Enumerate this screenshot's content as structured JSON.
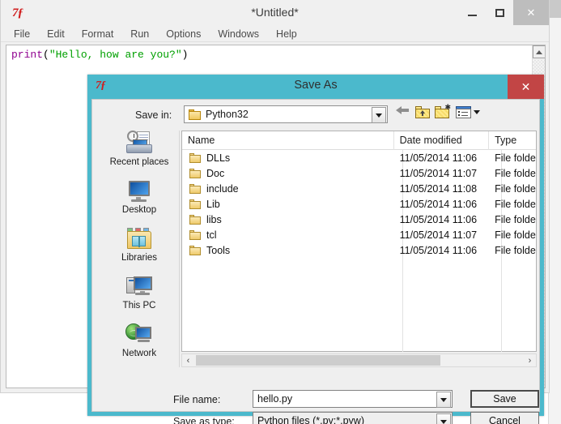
{
  "editor": {
    "window_title": "*Untitled*",
    "icon": "python-idle-icon",
    "icon_glyph": "7ƒ",
    "menus": [
      "File",
      "Edit",
      "Format",
      "Run",
      "Options",
      "Windows",
      "Help"
    ],
    "code": {
      "func": "print",
      "open_paren": "(",
      "string": "\"Hello, how are you?\"",
      "close_paren": ")"
    },
    "window_controls": {
      "minimize": "–",
      "maximize": "□",
      "close": "✕"
    }
  },
  "dialog": {
    "title": "Save As",
    "icon": "python-idle-icon",
    "icon_glyph": "7ƒ",
    "close_label": "✕",
    "save_in": {
      "label": "Save in:",
      "value": "Python32"
    },
    "toolbar": {
      "back": "back-arrow",
      "up": "up-one-level",
      "new_folder": "new-folder",
      "views": "change-view",
      "views_caret": "▾"
    },
    "places": [
      {
        "label": "Recent places",
        "icon": "recent-places-icon"
      },
      {
        "label": "Desktop",
        "icon": "desktop-icon"
      },
      {
        "label": "Libraries",
        "icon": "libraries-icon"
      },
      {
        "label": "This PC",
        "icon": "this-pc-icon"
      },
      {
        "label": "Network",
        "icon": "network-icon"
      }
    ],
    "file_list": {
      "sort_column": "Name",
      "sort_direction": "ascending",
      "columns": [
        "Name",
        "Date modified",
        "Type"
      ],
      "rows": [
        {
          "name": "DLLs",
          "date": "11/05/2014 11:06",
          "type": "File folder"
        },
        {
          "name": "Doc",
          "date": "11/05/2014 11:07",
          "type": "File folder"
        },
        {
          "name": "include",
          "date": "11/05/2014 11:08",
          "type": "File folder"
        },
        {
          "name": "Lib",
          "date": "11/05/2014 11:06",
          "type": "File folder"
        },
        {
          "name": "libs",
          "date": "11/05/2014 11:06",
          "type": "File folder"
        },
        {
          "name": "tcl",
          "date": "11/05/2014 11:07",
          "type": "File folder"
        },
        {
          "name": "Tools",
          "date": "11/05/2014 11:06",
          "type": "File folder"
        }
      ]
    },
    "hscroll": {
      "left": "‹",
      "right": "›"
    },
    "form": {
      "file_name_label": "File name:",
      "file_name_value": "hello.py",
      "file_type_label": "Save as type:",
      "file_type_value": "Python files (*.py;*.pyw)"
    },
    "buttons": {
      "save": "Save",
      "cancel": "Cancel"
    }
  },
  "colors": {
    "dialog_frame": "#4bb9cc",
    "close_button": "#c24545",
    "code_keyword": "#8f008f",
    "code_string": "#00a000"
  }
}
